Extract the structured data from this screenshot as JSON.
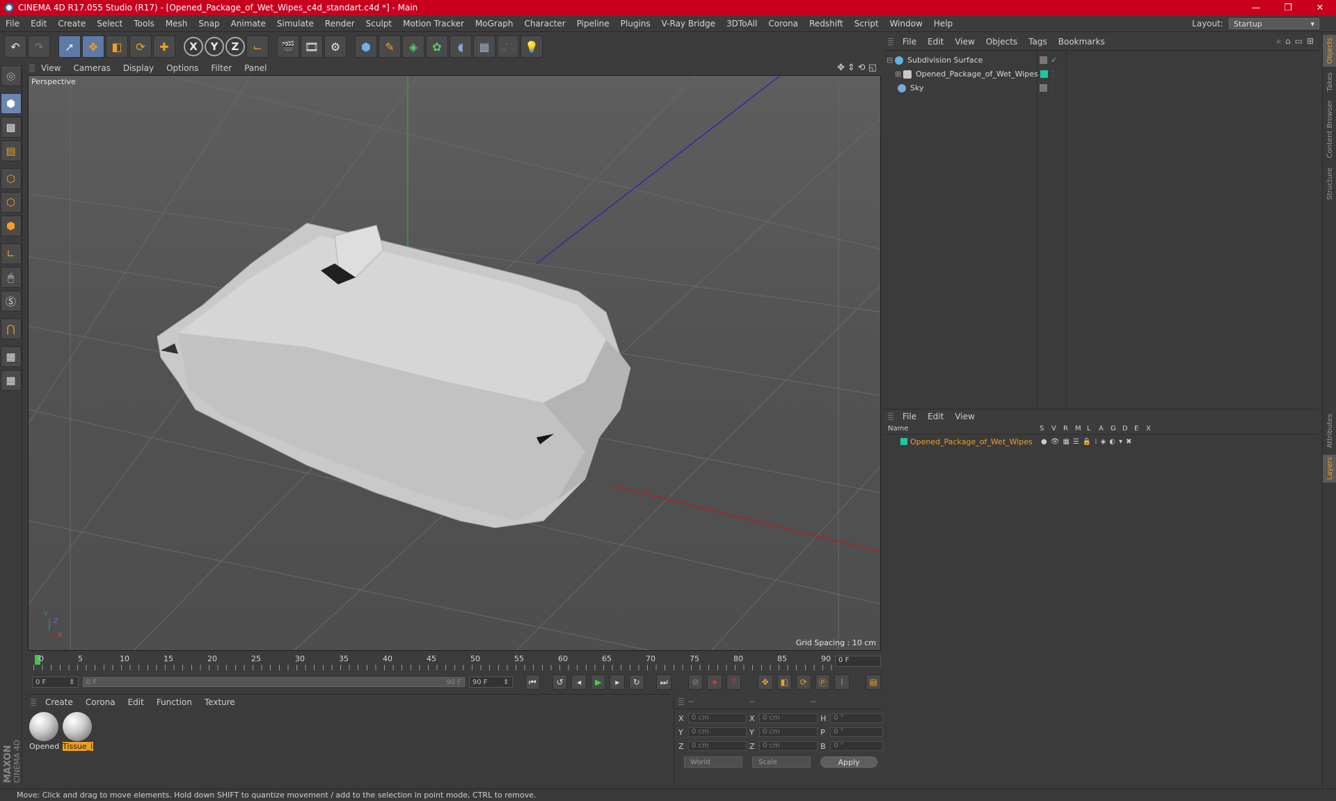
{
  "window": {
    "title": "CINEMA 4D R17.055 Studio (R17) - [Opened_Package_of_Wet_Wipes_c4d_standart.c4d *] - Main",
    "minimize": "—",
    "restore": "❐",
    "close": "✕"
  },
  "menubar": {
    "items": [
      "File",
      "Edit",
      "Create",
      "Select",
      "Tools",
      "Mesh",
      "Snap",
      "Animate",
      "Simulate",
      "Render",
      "Sculpt",
      "Motion Tracker",
      "MoGraph",
      "Character",
      "Pipeline",
      "Plugins",
      "V-Ray Bridge",
      "3DToAll",
      "Corona",
      "Redshift",
      "Script",
      "Window",
      "Help"
    ],
    "layout_label": "Layout:",
    "layout_value": "Startup"
  },
  "toolbar": {
    "icons": [
      "undo-icon",
      "redo-icon",
      "select-icon",
      "move-icon",
      "scale-icon",
      "rotate-icon",
      "transform-icon",
      "x-axis-icon",
      "y-axis-icon",
      "z-axis-icon",
      "coordinate-system-icon",
      "render-view-icon",
      "render-picture-viewer-icon",
      "render-settings-icon",
      "cube-icon",
      "pen-icon",
      "subdivision-icon",
      "cloner-icon",
      "deformer-icon",
      "floor-icon",
      "camera-icon",
      "light-icon"
    ],
    "x_label": "X",
    "y_label": "Y",
    "z_label": "Z"
  },
  "viewport": {
    "menu": [
      "View",
      "Cameras",
      "Display",
      "Options",
      "Filter",
      "Panel"
    ],
    "camera_label": "Perspective",
    "grid_spacing": "Grid Spacing : 10 cm",
    "axis_y": "Y",
    "axis_z": "Z",
    "axis_x": "X"
  },
  "timeline": {
    "ticks": [
      "0",
      "5",
      "10",
      "15",
      "20",
      "25",
      "30",
      "35",
      "40",
      "45",
      "50",
      "55",
      "60",
      "65",
      "70",
      "75",
      "80",
      "85",
      "90"
    ],
    "current_frame": "0 F",
    "start_field": "0 F",
    "slider_start": "0 F",
    "slider_end": "90 F",
    "end_field": "90 F",
    "frame_right": "0 F"
  },
  "materials": {
    "menu": [
      "Create",
      "Corona",
      "Edit",
      "Function",
      "Texture"
    ],
    "items": [
      {
        "name": "Opened",
        "active": false
      },
      {
        "name": "Tissue_l",
        "active": true
      }
    ]
  },
  "coordinates": {
    "header": [
      "--",
      "--",
      "--"
    ],
    "rows": [
      {
        "l1": "X",
        "v1": "0 cm",
        "l2": "X",
        "v2": "0 cm",
        "l3": "H",
        "v3": "0 °"
      },
      {
        "l1": "Y",
        "v1": "0 cm",
        "l2": "Y",
        "v2": "0 cm",
        "l3": "P",
        "v3": "0 °"
      },
      {
        "l1": "Z",
        "v1": "0 cm",
        "l2": "Z",
        "v2": "0 cm",
        "l3": "B",
        "v3": "0 °"
      }
    ],
    "world": "World",
    "scale": "Scale",
    "apply": "Apply"
  },
  "status": "Move: Click and drag to move elements. Hold down SHIFT to quantize movement / add to the selection in point mode, CTRL to remove.",
  "logo": {
    "brand": "MAXON",
    "product": "CINEMA 4D"
  },
  "object_manager": {
    "menu": [
      "File",
      "Edit",
      "View",
      "Objects",
      "Tags",
      "Bookmarks"
    ],
    "objects": [
      {
        "name": "Subdivision Surface",
        "icon_color": "#5fb2e8"
      },
      {
        "name": "Opened_Package_of_Wet_Wipes",
        "icon_color": "#c8c8c8"
      },
      {
        "name": "Sky",
        "icon_color": "#7aa8d8"
      }
    ]
  },
  "layer_manager": {
    "menu": [
      "File",
      "Edit",
      "View"
    ],
    "columns": [
      "Name",
      "S",
      "V",
      "R",
      "M",
      "L",
      "A",
      "G",
      "D",
      "E",
      "X"
    ],
    "layers": [
      {
        "name": "Opened_Package_of_Wet_Wipes",
        "color": "#1fc6a4"
      }
    ]
  },
  "side_tabs": [
    "Objects",
    "Takes",
    "Content Browser",
    "Structure",
    "Attributes",
    "Layers"
  ],
  "colors": {
    "title_bar": "#c8001e",
    "accent": "#f0a020",
    "layer_color": "#1fc6a4"
  }
}
